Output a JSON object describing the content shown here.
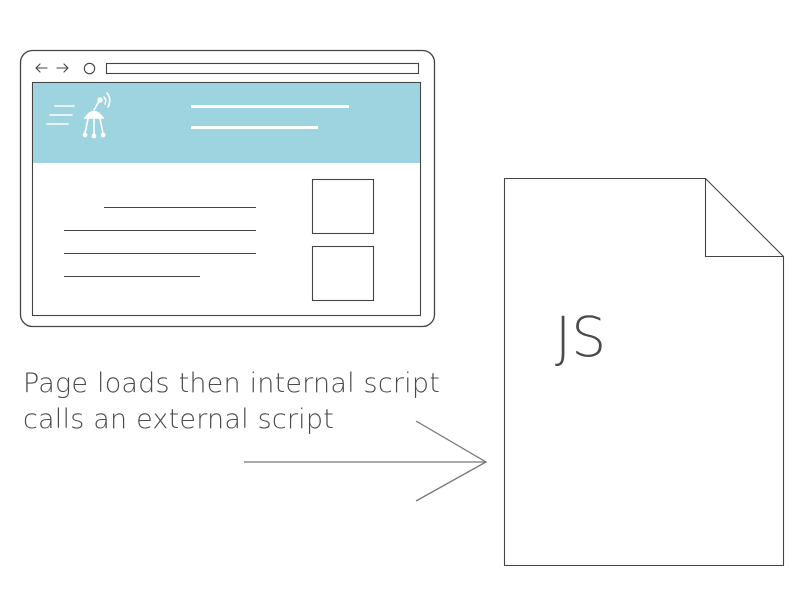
{
  "caption": {
    "line1": "Page loads then internal script",
    "line2": "calls an external script"
  },
  "file": {
    "label": "JS"
  },
  "colors": {
    "stroke": "#444444",
    "header_band": "#9dd4df",
    "header_lines": "#ffffff",
    "text": "#4a4a4a",
    "arrow": "#777777"
  },
  "icons": {
    "back": "arrow-left",
    "forward": "arrow-right",
    "reload": "circle",
    "logo": "satellite-robot"
  }
}
